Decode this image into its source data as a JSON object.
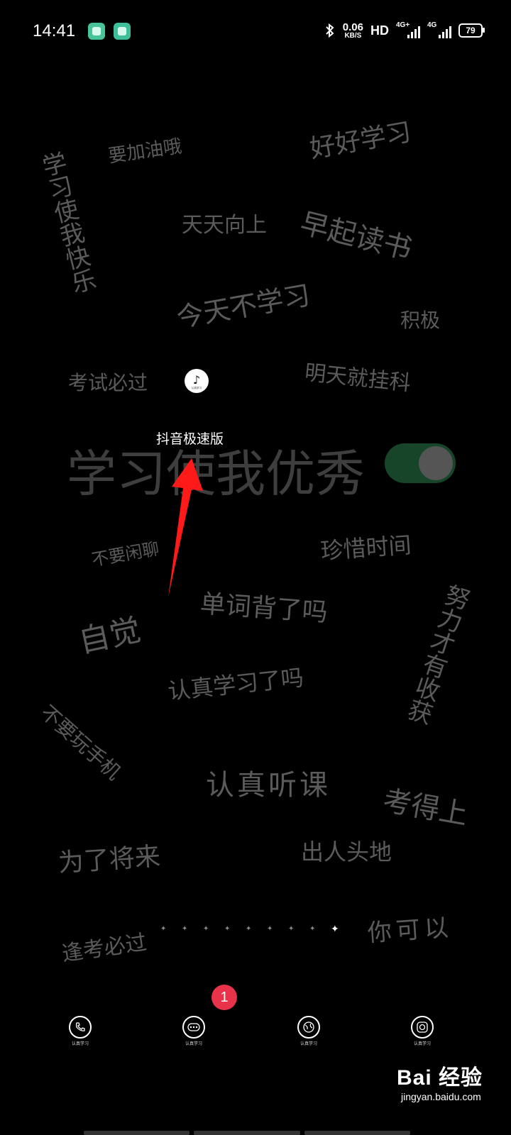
{
  "status_bar": {
    "time": "14:41",
    "net_speed_value": "0.06",
    "net_speed_unit": "KB/S",
    "hd_label": "HD",
    "sim1_label": "4G+",
    "sim2_label": "4G",
    "battery_level": "79"
  },
  "wallpaper_words": {
    "w1": "要加油哦",
    "w2": "好好学习",
    "w3": "学习使我快乐",
    "w4": "天天向上",
    "w5": "早起读书",
    "w6": "今天不学习",
    "w7": "积极",
    "w8": "考试必过",
    "w9": "明天就挂科",
    "w10": "学习使我优秀",
    "w11": "不要闲聊",
    "w12": "珍惜时间",
    "w13": "单词背了吗",
    "w14": "努力才有收获",
    "w15": "自觉",
    "w16": "认真学习了吗",
    "w17": "不要玩手机",
    "w18": "认真听课",
    "w19": "考得上",
    "w20": "为了将来",
    "w21": "出人头地",
    "w22": "逢考必过",
    "w23": "你可以"
  },
  "app": {
    "label": "抖音极速版",
    "icon_caption": "认真学习"
  },
  "annotation": {
    "arrow_color": "#ff1a1a"
  },
  "pager": {
    "page_count": 9,
    "active_page": 9
  },
  "dock": {
    "badge_count": "1",
    "items": [
      {
        "name": "phone",
        "caption": "认真学习"
      },
      {
        "name": "messages",
        "caption": "认真学习"
      },
      {
        "name": "browser",
        "caption": "认真学习"
      },
      {
        "name": "camera",
        "caption": "认真学习"
      }
    ]
  },
  "watermark": {
    "logo": "Bai 经验",
    "url": "jingyan.baidu.com"
  },
  "colors": {
    "background": "#000000",
    "word_gray": "#5b5b5b",
    "badge": "#e8334a",
    "toggle_track": "#16452a"
  }
}
